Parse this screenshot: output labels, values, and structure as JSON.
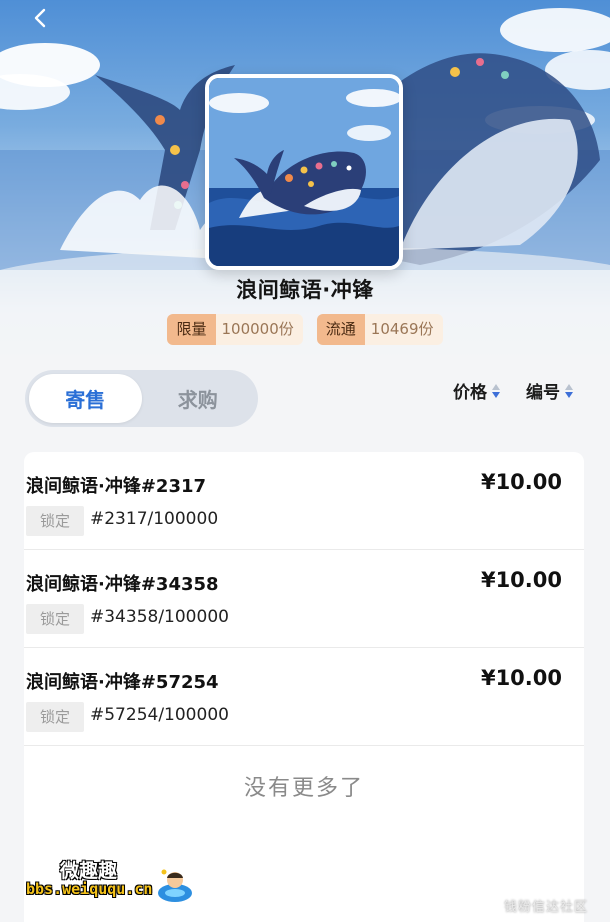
{
  "header": {
    "back_icon": "chevron-left-icon"
  },
  "collection": {
    "title": "浪间鲸语·冲锋",
    "limit": {
      "label": "限量",
      "value": "100000份"
    },
    "circulation": {
      "label": "流通",
      "value": "10469份"
    }
  },
  "tabs": [
    {
      "label": "寄售",
      "active": true
    },
    {
      "label": "求购",
      "active": false
    }
  ],
  "sort": {
    "price_label": "价格",
    "number_label": "编号"
  },
  "listings": [
    {
      "name": "浪间鲸语·冲锋#2317",
      "price": "¥10.00",
      "status": "锁定",
      "serial": "#2317/100000"
    },
    {
      "name": "浪间鲸语·冲锋#34358",
      "price": "¥10.00",
      "status": "锁定",
      "serial": "#34358/100000"
    },
    {
      "name": "浪间鲸语·冲锋#57254",
      "price": "¥10.00",
      "status": "锁定",
      "serial": "#57254/100000"
    }
  ],
  "no_more_text": "没有更多了",
  "watermark": {
    "brand": "微趣趣",
    "url": "bbs.weiququ.cn",
    "right_text": "钱粉信达社区"
  },
  "colors": {
    "accent": "#2a6fd6",
    "badge_key": "#f2b98d",
    "badge_value": "#fbefe2"
  }
}
